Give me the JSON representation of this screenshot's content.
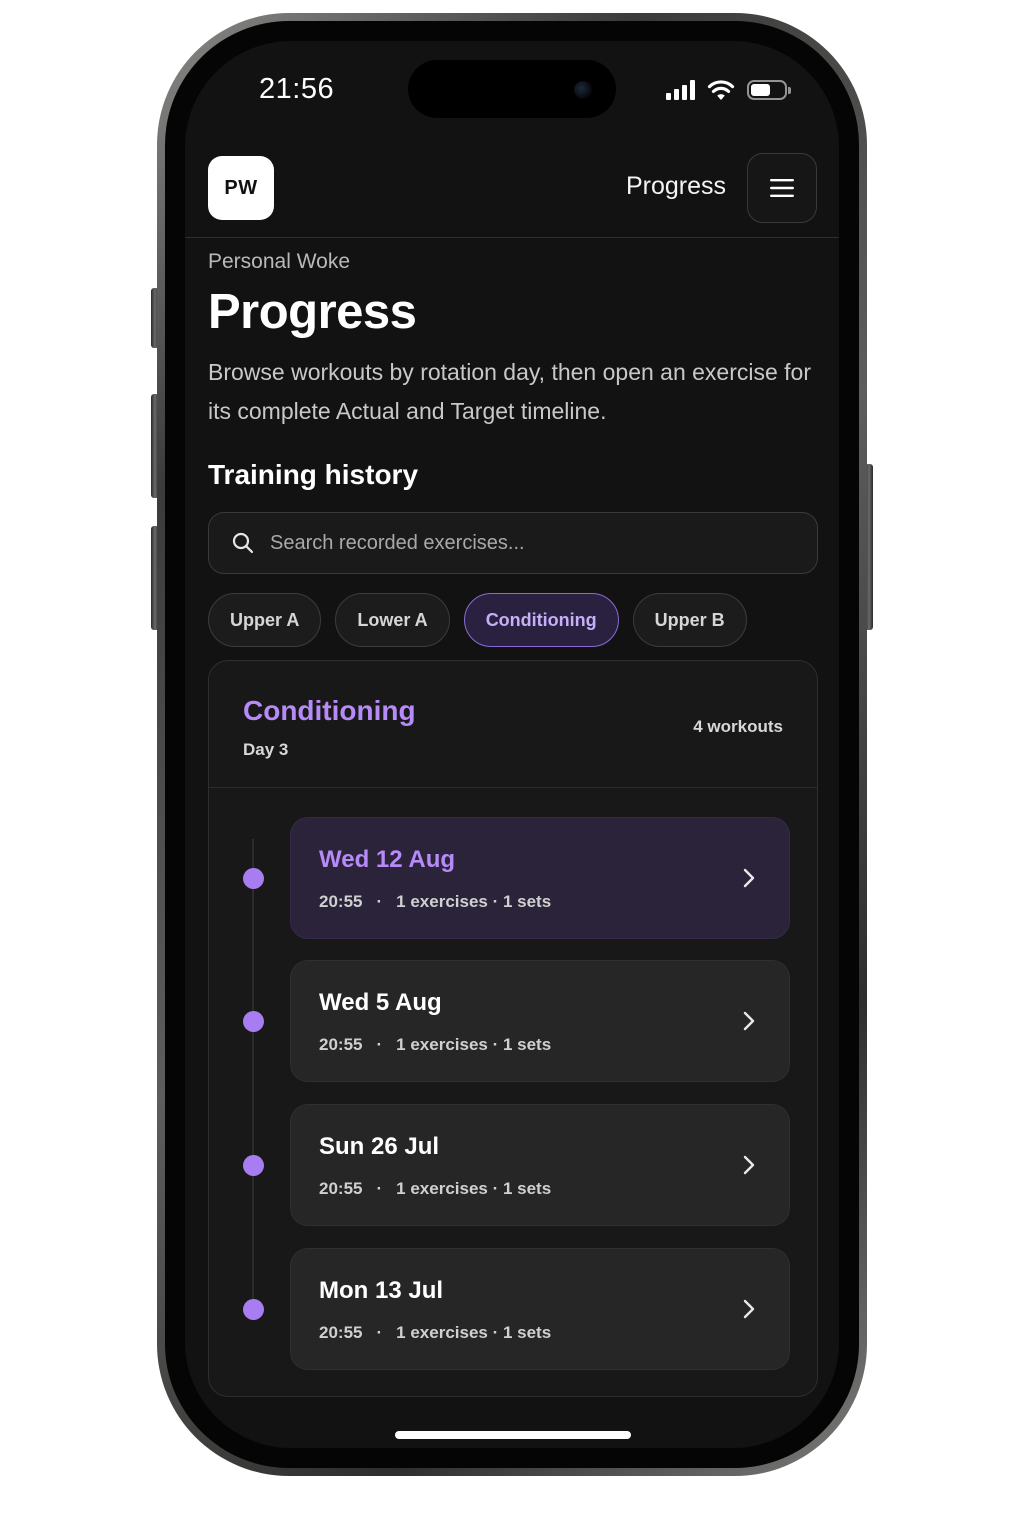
{
  "status_bar": {
    "time": "21:56",
    "icons": [
      "signal-icon",
      "wifi-icon",
      "battery-icon"
    ],
    "battery_level": 0.6
  },
  "header": {
    "logo_text": "PW",
    "title": "Progress",
    "menu_icon": "menu-icon"
  },
  "page": {
    "eyebrow": "Personal Woke",
    "title": "Progress",
    "description": "Browse workouts by rotation day, then open an exercise for its complete Actual and Target timeline."
  },
  "history": {
    "section_title": "Training history",
    "search": {
      "placeholder": "Search recorded exercises...",
      "icon": "search-icon"
    },
    "filters": [
      {
        "label": "Upper A",
        "active": false
      },
      {
        "label": "Lower A",
        "active": false
      },
      {
        "label": "Conditioning",
        "active": true
      },
      {
        "label": "Upper B",
        "active": false
      }
    ],
    "group": {
      "title": "Conditioning",
      "subtitle": "Day 3",
      "count": "4 workouts"
    },
    "workouts": [
      {
        "date": "Wed 12 Aug",
        "time": "20:55",
        "separator": "·",
        "summary": "1 exercises · 1 sets",
        "highlighted": true
      },
      {
        "date": "Wed 5 Aug",
        "time": "20:55",
        "separator": "·",
        "summary": "1 exercises · 1 sets",
        "highlighted": false
      },
      {
        "date": "Sun 26 Jul",
        "time": "20:55",
        "separator": "·",
        "summary": "1 exercises · 1 sets",
        "highlighted": false
      },
      {
        "date": "Mon 13 Jul",
        "time": "20:55",
        "separator": "·",
        "summary": "1 exercises · 1 sets",
        "highlighted": false
      }
    ]
  },
  "colors": {
    "accent": "#b68af7",
    "timeline_dot": "#a97df2",
    "background": "#121212",
    "card": "#262626"
  }
}
